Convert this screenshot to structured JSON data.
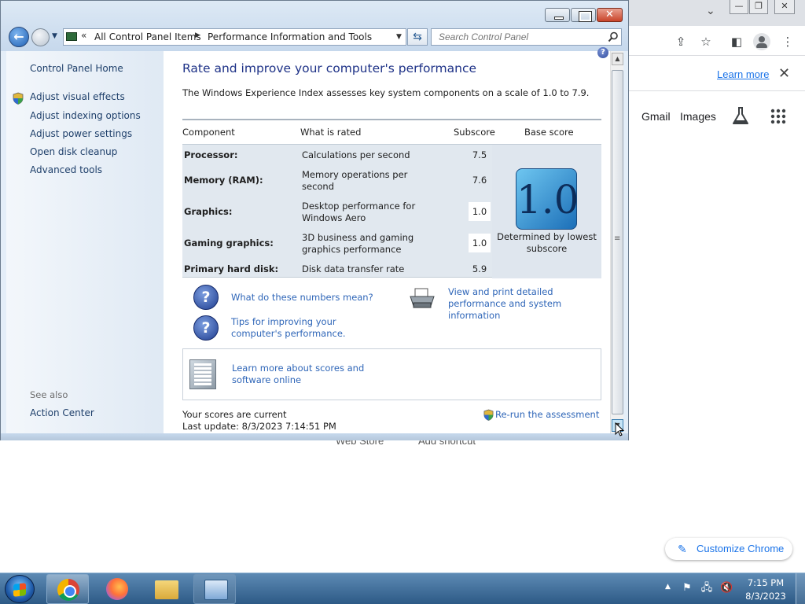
{
  "chrome": {
    "learn_more": "Learn more",
    "close_glyph": "✕",
    "links": {
      "gmail": "Gmail",
      "images": "Images"
    },
    "ghost": {
      "web_store": "Web Store",
      "add_shortcut": "Add shortcut"
    },
    "customize": "Customize Chrome",
    "icons": {
      "share": "share-icon",
      "star": "star-icon",
      "sidebar": "side-panel-icon",
      "menu": "kebab-menu-icon",
      "labs": "labs-flask-icon",
      "apps": "apps-grid-icon"
    }
  },
  "window": {
    "breadcrumb": {
      "root": "All Control Panel Items",
      "current": "Performance Information and Tools"
    },
    "search_placeholder": "Search Control Panel",
    "left_nav": {
      "home": "Control Panel Home",
      "links": [
        "Adjust visual effects",
        "Adjust indexing options",
        "Adjust power settings",
        "Open disk cleanup",
        "Advanced tools"
      ],
      "see_also": "See also",
      "action_center": "Action Center"
    },
    "title": "Rate and improve your computer's performance",
    "intro": "The Windows Experience Index assesses key system components on a scale of 1.0 to 7.9.",
    "table": {
      "headers": {
        "component": "Component",
        "rated": "What is rated",
        "subscore": "Subscore",
        "base": "Base score"
      },
      "rows": [
        {
          "component": "Processor:",
          "rated": "Calculations per second",
          "subscore": "7.5"
        },
        {
          "component": "Memory (RAM):",
          "rated": "Memory operations per second",
          "subscore": "7.6"
        },
        {
          "component": "Graphics:",
          "rated": "Desktop performance for Windows Aero",
          "subscore": "1.0"
        },
        {
          "component": "Gaming graphics:",
          "rated": "3D business and gaming graphics performance",
          "subscore": "1.0"
        },
        {
          "component": "Primary hard disk:",
          "rated": "Disk data transfer rate",
          "subscore": "5.9"
        }
      ],
      "base_score": "1.0",
      "base_caption": "Determined by lowest subscore"
    },
    "links": {
      "numbers_mean": "What do these numbers mean?",
      "tips": "Tips for improving your computer's performance.",
      "view_print": "View and print detailed performance and system information",
      "learn_more_scores": "Learn more about scores and software online"
    },
    "status": {
      "current": "Your scores are current",
      "last_update": "Last update: 8/3/2023 7:14:51 PM"
    },
    "rerun": "Re-run the assessment"
  },
  "taskbar": {
    "clock_time": "7:15 PM",
    "clock_date": "8/3/2023",
    "pinned": [
      "Google Chrome",
      "Firefox",
      "Windows Explorer",
      "Control Panel"
    ]
  }
}
